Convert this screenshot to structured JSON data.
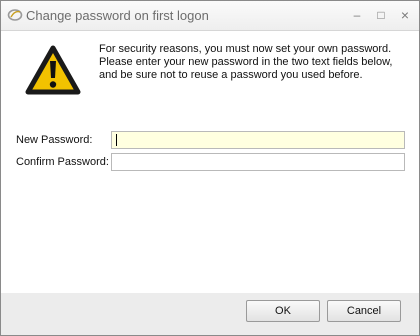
{
  "window": {
    "title": "Change password on first logon",
    "icon": "app-swirl-icon",
    "controls": {
      "minimize_icon": "minimize-icon",
      "maximize_icon": "maximize-icon",
      "close_icon": "close-icon"
    }
  },
  "dialog": {
    "icon": "warning-icon",
    "message": "For security reasons, you must now set your own password.\nPlease enter your new password in the two text fields below,\nand be sure not to reuse a password you used before.",
    "new_password": {
      "label": "New Password:",
      "value": "",
      "placeholder": ""
    },
    "confirm_password": {
      "label": "Confirm Password:",
      "value": "",
      "placeholder": ""
    }
  },
  "buttons": {
    "ok": "OK",
    "cancel": "Cancel"
  },
  "colors": {
    "focused_field_bg": "#ffffe0",
    "warning_yellow": "#f5c400"
  }
}
